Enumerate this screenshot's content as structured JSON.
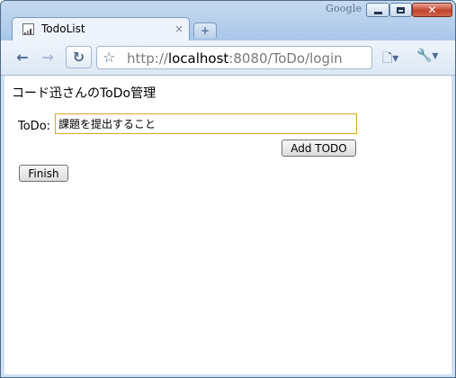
{
  "window": {
    "brand": "Google",
    "tab_title": "TodoList",
    "tab_close": "×",
    "new_tab": "+"
  },
  "toolbar": {
    "back": "←",
    "forward": "→",
    "reload": "↻",
    "star": "☆",
    "url_scheme": "http://",
    "url_host": "localhost",
    "url_rest": ":8080/ToDo/login",
    "go": "▶",
    "page_menu": "🗋▾",
    "tools_menu": "🔧▾"
  },
  "page": {
    "heading": "コード迅さんのToDo管理",
    "todo_label": "ToDo:",
    "todo_value": "課題を提出すること",
    "add_button": "Add TODO",
    "finish_button": "Finish"
  }
}
